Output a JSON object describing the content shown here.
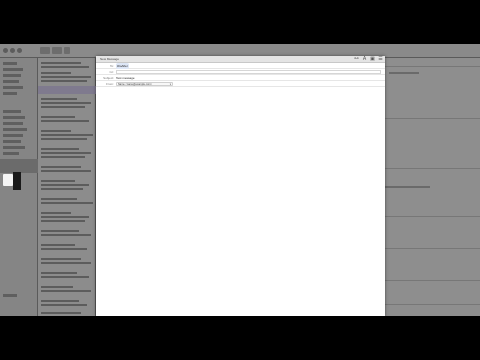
{
  "compose": {
    "title": "New Message",
    "to_label": "To:",
    "to_value": "iDoAfter",
    "cc_label": "Cc:",
    "subject_label": "Subject:",
    "subject_value": "Test message",
    "from_label": "From:",
    "from_value": "Name <name@example.com>",
    "toolbar_icons": [
      "paperclip-icon",
      "font-icon",
      "photo-icon",
      "format-icon"
    ]
  },
  "background_app": {
    "name": "Mail",
    "dimmed": true
  },
  "colors": {
    "backdrop": "#000000",
    "dim_overlay": "#7a7a7a",
    "compose_bg": "#ffffff",
    "token_bg": "#dde6f6"
  }
}
